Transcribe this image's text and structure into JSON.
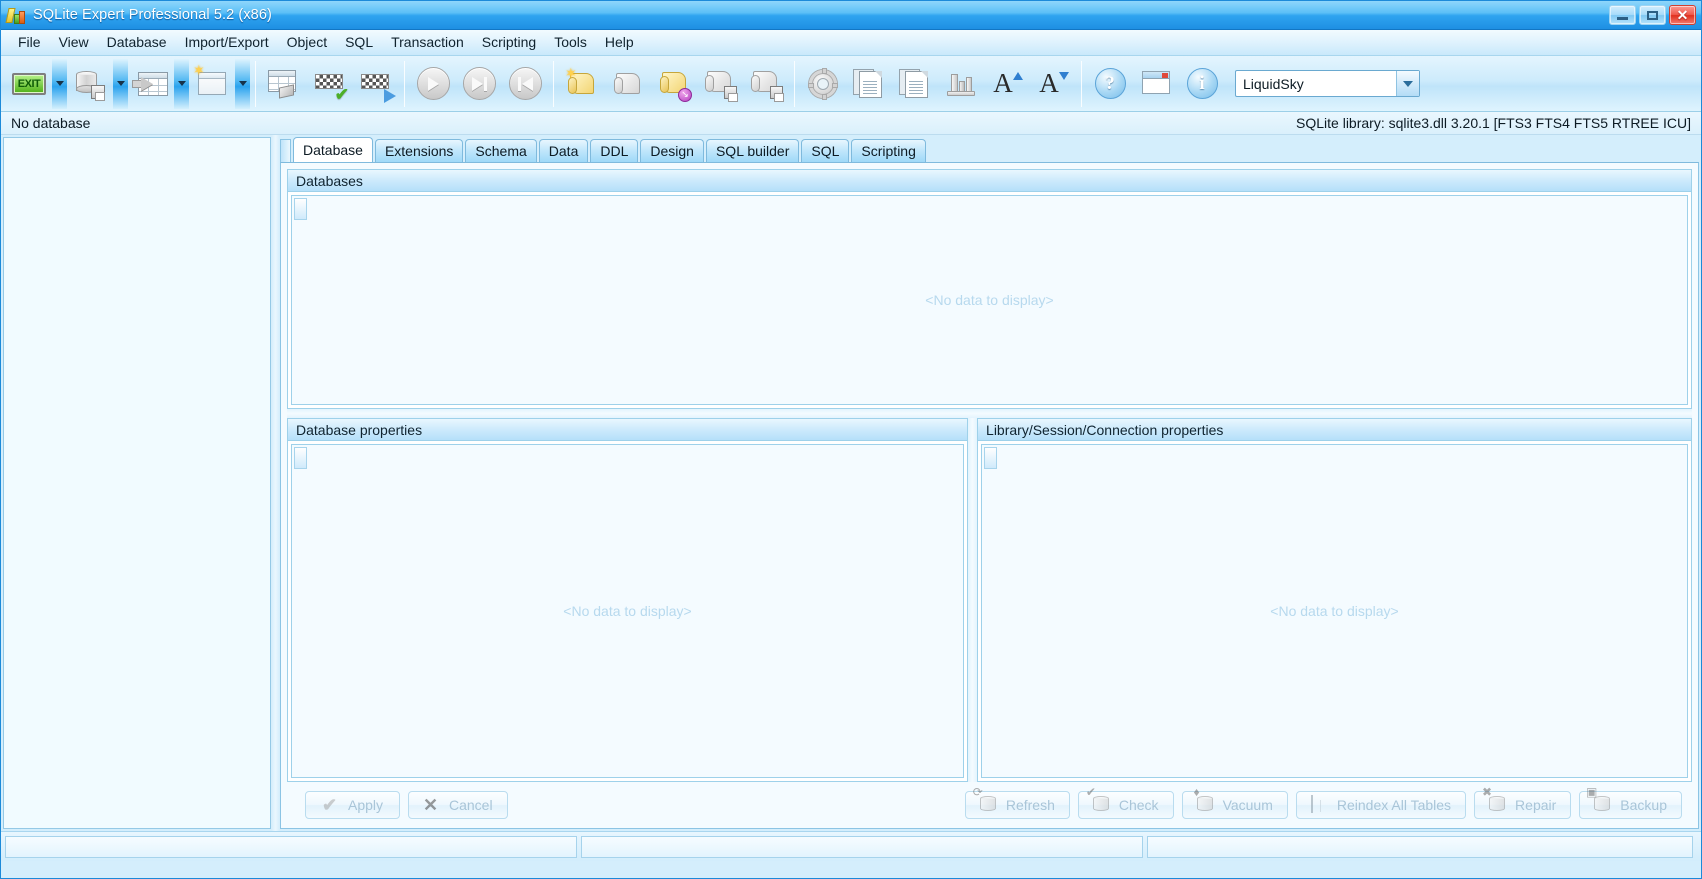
{
  "window": {
    "title": "SQLite Expert Professional 5.2 (x86)",
    "minimize_label": "",
    "maximize_label": "",
    "close_label": "✕",
    "accent_color": "#2fa4f0"
  },
  "menubar": {
    "items": [
      {
        "label": "File"
      },
      {
        "label": "View"
      },
      {
        "label": "Database"
      },
      {
        "label": "Import/Export"
      },
      {
        "label": "Object"
      },
      {
        "label": "SQL"
      },
      {
        "label": "Transaction"
      },
      {
        "label": "Scripting"
      },
      {
        "label": "Tools"
      },
      {
        "label": "Help"
      }
    ]
  },
  "toolbar": {
    "buttons": [
      {
        "name": "exit-button",
        "icon": "exit-icon",
        "label": "EXIT",
        "has_dropdown": true
      },
      {
        "name": "save-database-button",
        "icon": "database-save-icon",
        "has_dropdown": true
      },
      {
        "name": "import-table-button",
        "icon": "table-import-icon",
        "has_dropdown": true
      },
      {
        "name": "new-window-button",
        "icon": "new-window-icon",
        "has_dropdown": true
      },
      {
        "name": "design-table-button",
        "icon": "table-design-icon",
        "has_dropdown": false
      },
      {
        "name": "apply-data-button",
        "icon": "grid-check-icon",
        "has_dropdown": false
      },
      {
        "name": "run-data-button",
        "icon": "grid-play-icon",
        "has_dropdown": false
      },
      {
        "name": "execute-button",
        "icon": "play-circle-icon",
        "has_dropdown": false
      },
      {
        "name": "execute-step-button",
        "icon": "play-to-end-circle-icon",
        "has_dropdown": false
      },
      {
        "name": "execute-back-button",
        "icon": "play-to-start-circle-icon",
        "has_dropdown": false
      },
      {
        "name": "new-sql-button",
        "icon": "script-new-icon",
        "has_dropdown": false
      },
      {
        "name": "clear-sql-button",
        "icon": "script-clear-icon",
        "has_dropdown": false
      },
      {
        "name": "load-sql-button",
        "icon": "script-load-icon",
        "has_dropdown": false
      },
      {
        "name": "save-sql-button",
        "icon": "script-save-icon",
        "has_dropdown": false
      },
      {
        "name": "save-sql-as-button",
        "icon": "script-save-as-icon",
        "has_dropdown": false
      },
      {
        "name": "options-button",
        "icon": "gear-icon",
        "has_dropdown": false
      },
      {
        "name": "copy-button",
        "icon": "copy-icon",
        "has_dropdown": false
      },
      {
        "name": "paste-button",
        "icon": "paste-icon",
        "has_dropdown": false
      },
      {
        "name": "chart-button",
        "icon": "bar-chart-icon",
        "has_dropdown": false
      },
      {
        "name": "increase-font-button",
        "icon": "font-increase-icon",
        "label": "A",
        "has_dropdown": false
      },
      {
        "name": "decrease-font-button",
        "icon": "font-decrease-icon",
        "label": "A",
        "has_dropdown": false
      },
      {
        "name": "help-button",
        "icon": "question-mark-icon",
        "label": "?",
        "has_dropdown": false
      },
      {
        "name": "check-updates-button",
        "icon": "window-download-icon",
        "has_dropdown": false
      },
      {
        "name": "about-button",
        "icon": "info-icon",
        "label": "i",
        "has_dropdown": false
      }
    ],
    "theme_combo": {
      "value": "LiquidSky",
      "icon": "chevron-down-icon"
    }
  },
  "infobar": {
    "database_status": "No database",
    "library_info": "SQLite library: sqlite3.dll 3.20.1 [FTS3 FTS4 FTS5 RTREE ICU]"
  },
  "sidebar": {
    "items": []
  },
  "tabs": [
    {
      "label": "Database",
      "active": true
    },
    {
      "label": "Extensions",
      "active": false
    },
    {
      "label": "Schema",
      "active": false
    },
    {
      "label": "Data",
      "active": false
    },
    {
      "label": "DDL",
      "active": false
    },
    {
      "label": "Design",
      "active": false
    },
    {
      "label": "SQL builder",
      "active": false
    },
    {
      "label": "SQL",
      "active": false
    },
    {
      "label": "Scripting",
      "active": false
    }
  ],
  "panels": {
    "databases": {
      "title": "Databases",
      "empty_text": "<No data to display>"
    },
    "database_properties": {
      "title": "Database properties",
      "empty_text": "<No data to display>"
    },
    "library_properties": {
      "title": "Library/Session/Connection properties",
      "empty_text": "<No data to display>"
    }
  },
  "action_buttons": {
    "left": [
      {
        "name": "apply-button",
        "label": "Apply",
        "icon": "check-icon",
        "disabled": true
      },
      {
        "name": "cancel-button",
        "label": "Cancel",
        "icon": "x-icon",
        "disabled": true
      }
    ],
    "right": [
      {
        "name": "refresh-button",
        "label": "Refresh",
        "icon": "database-refresh-icon",
        "disabled": true
      },
      {
        "name": "check-button",
        "label": "Check",
        "icon": "database-check-icon",
        "disabled": true
      },
      {
        "name": "vacuum-button",
        "label": "Vacuum",
        "icon": "database-vacuum-icon",
        "disabled": true
      },
      {
        "name": "reindex-all-tables-button",
        "label": "Reindex All Tables",
        "icon": "table-reindex-icon",
        "disabled": true
      },
      {
        "name": "repair-button",
        "label": "Repair",
        "icon": "database-repair-icon",
        "disabled": true
      },
      {
        "name": "backup-button",
        "label": "Backup",
        "icon": "database-backup-icon",
        "disabled": true
      }
    ]
  },
  "statusbar": {
    "panel1": "",
    "panel2": "",
    "panel3": ""
  }
}
